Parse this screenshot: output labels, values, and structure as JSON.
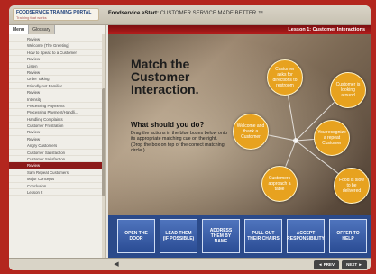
{
  "header": {
    "logo_text": "FOODSERVICE TRAINING PORTAL",
    "logo_subtext": "Training that works",
    "course_prefix": "Foodservice eStart:",
    "course_title": "CUSTOMER SERVICE MADE BETTER.™",
    "lesson_title": "Lesson 1: Customer Interactions"
  },
  "sidebar": {
    "tabs": [
      {
        "label": "Menu"
      },
      {
        "label": "Glossary"
      }
    ],
    "items": [
      {
        "label": "Review"
      },
      {
        "label": "Welcome (The Greeting)"
      },
      {
        "label": "How to Speak to a Customer"
      },
      {
        "label": "Review"
      },
      {
        "label": "Listen"
      },
      {
        "label": "Review"
      },
      {
        "label": "Order Taking"
      },
      {
        "label": "Friendly not Familiar"
      },
      {
        "label": "Review"
      },
      {
        "label": "Intensity"
      },
      {
        "label": "Processing Payments"
      },
      {
        "label": "Processing Payment/Handli..."
      },
      {
        "label": "Handling Complaints"
      },
      {
        "label": "Customer Frustration"
      },
      {
        "label": "Review"
      },
      {
        "label": "Review"
      },
      {
        "label": "Angry Customers"
      },
      {
        "label": "Customer Satisfaction"
      },
      {
        "label": "Customer Satisfaction"
      },
      {
        "label": "Review"
      },
      {
        "label": "Sam Repeat Customers"
      },
      {
        "label": "Major Concepts"
      },
      {
        "label": "Conclusion"
      },
      {
        "label": "Lesson 2"
      }
    ],
    "current_index": 19
  },
  "stage": {
    "headline": "Match the Customer Interaction.",
    "question": "What should you do?",
    "instructions": "Drag the actions in the blue boxes below onto its appropriate matching cue on the right. (Drop the box on top of the correct matching circle.)",
    "circles": [
      {
        "label": "Customer asks for directions to restroom"
      },
      {
        "label": "Customer is looking around"
      },
      {
        "label": "Welcome and thank a Customer"
      },
      {
        "label": "You recognize a repeat Customer"
      },
      {
        "label": "Customers approach a table"
      },
      {
        "label": "Food is slow to be delivered"
      }
    ]
  },
  "actions": [
    {
      "label": "OPEN THE DOOR"
    },
    {
      "label": "LEAD THEM (IF POSSIBLE)"
    },
    {
      "label": "ADDRESS THEM BY NAME"
    },
    {
      "label": "PULL OUT THEIR CHAIRS"
    },
    {
      "label": "ACCEPT RESPONSIBILITY"
    },
    {
      "label": "OFFER TO HELP"
    }
  ],
  "nav": {
    "prev_label": "◄ PREV",
    "next_label": "NEXT ►"
  },
  "colors": {
    "border_red": "#b3261e",
    "accent_red": "#8c1b1a",
    "circle_orange": "#e7a21f",
    "action_blue": "#2b4a8a"
  }
}
